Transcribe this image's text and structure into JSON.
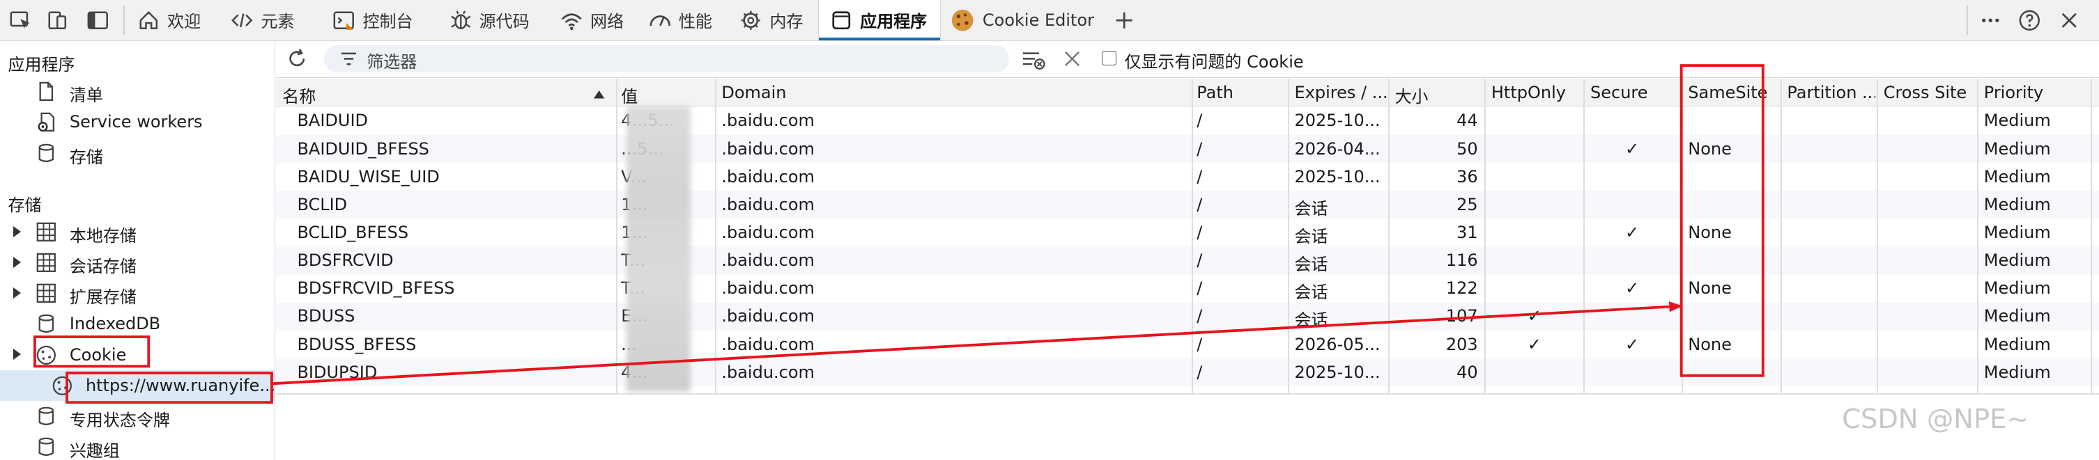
{
  "toolbar": {
    "tabs": [
      {
        "label": "欢迎",
        "icon": "home-icon"
      },
      {
        "label": "元素",
        "icon": "code-icon"
      },
      {
        "label": "控制台",
        "icon": "console-icon"
      },
      {
        "label": "源代码",
        "icon": "bug-icon"
      },
      {
        "label": "网络",
        "icon": "wifi-icon"
      },
      {
        "label": "性能",
        "icon": "gauge-icon"
      },
      {
        "label": "内存",
        "icon": "gear-icon"
      },
      {
        "label": "应用程序",
        "icon": "app-window-icon"
      },
      {
        "label": "Cookie Editor",
        "icon": "cookie-icon"
      }
    ],
    "active_tab": "应用程序"
  },
  "sidebar": {
    "app_section_title": "应用程序",
    "app_items": [
      {
        "label": "清单",
        "icon": "document-icon"
      },
      {
        "label": "Service workers",
        "icon": "gear-doc-icon"
      },
      {
        "label": "存储",
        "icon": "database-icon"
      }
    ],
    "storage_section_title": "存储",
    "storage_items": [
      {
        "label": "本地存储",
        "icon": "grid-icon",
        "expandable": true
      },
      {
        "label": "会话存储",
        "icon": "grid-icon",
        "expandable": true
      },
      {
        "label": "扩展存储",
        "icon": "grid-icon",
        "expandable": true
      },
      {
        "label": "IndexedDB",
        "icon": "database-icon",
        "expandable": false
      },
      {
        "label": "Cookie",
        "icon": "cookie-icon",
        "expandable": true
      },
      {
        "label": "https://www.ruanyife...",
        "icon": "cookie-icon",
        "expandable": false,
        "selected": true
      },
      {
        "label": "专用状态令牌",
        "icon": "database-icon",
        "expandable": false
      },
      {
        "label": "兴趣组",
        "icon": "database-icon",
        "expandable": false
      }
    ]
  },
  "filter": {
    "placeholder": "筛选器",
    "only_issues_label": "仅显示有问题的 Cookie"
  },
  "table": {
    "columns": [
      "名称",
      "值",
      "Domain",
      "Path",
      "Expires / ...",
      "大小",
      "HttpOnly",
      "Secure",
      "SameSite",
      "Partition ...",
      "Cross Site",
      "Priority"
    ],
    "rows": [
      {
        "name": "BAIDUID",
        "value": "4...5...",
        "domain": ".baidu.com",
        "path": "/",
        "expires": "2025-10...",
        "size": "44",
        "httponly": "",
        "secure": "",
        "samesite": "",
        "partition": "",
        "crosssite": "",
        "priority": "Medium"
      },
      {
        "name": "BAIDUID_BFESS",
        "value": "...5...",
        "domain": ".baidu.com",
        "path": "/",
        "expires": "2026-04...",
        "size": "50",
        "httponly": "",
        "secure": "✓",
        "samesite": "None",
        "partition": "",
        "crosssite": "",
        "priority": "Medium"
      },
      {
        "name": "BAIDU_WISE_UID",
        "value": "V...",
        "domain": ".baidu.com",
        "path": "/",
        "expires": "2025-10...",
        "size": "36",
        "httponly": "",
        "secure": "",
        "samesite": "",
        "partition": "",
        "crosssite": "",
        "priority": "Medium"
      },
      {
        "name": "BCLID",
        "value": "1...",
        "domain": ".baidu.com",
        "path": "/",
        "expires": "会话",
        "size": "25",
        "httponly": "",
        "secure": "",
        "samesite": "",
        "partition": "",
        "crosssite": "",
        "priority": "Medium"
      },
      {
        "name": "BCLID_BFESS",
        "value": "1...",
        "domain": ".baidu.com",
        "path": "/",
        "expires": "会话",
        "size": "31",
        "httponly": "",
        "secure": "✓",
        "samesite": "None",
        "partition": "",
        "crosssite": "",
        "priority": "Medium"
      },
      {
        "name": "BDSFRCVID",
        "value": "T...",
        "domain": ".baidu.com",
        "path": "/",
        "expires": "会话",
        "size": "116",
        "httponly": "",
        "secure": "",
        "samesite": "",
        "partition": "",
        "crosssite": "",
        "priority": "Medium"
      },
      {
        "name": "BDSFRCVID_BFESS",
        "value": "T...",
        "domain": ".baidu.com",
        "path": "/",
        "expires": "会话",
        "size": "122",
        "httponly": "",
        "secure": "✓",
        "samesite": "None",
        "partition": "",
        "crosssite": "",
        "priority": "Medium"
      },
      {
        "name": "BDUSS",
        "value": "E...",
        "domain": ".baidu.com",
        "path": "/",
        "expires": "会话",
        "size": "107",
        "httponly": "✓",
        "secure": "",
        "samesite": "",
        "partition": "",
        "crosssite": "",
        "priority": "Medium"
      },
      {
        "name": "BDUSS_BFESS",
        "value": "...",
        "domain": ".baidu.com",
        "path": "/",
        "expires": "2026-05...",
        "size": "203",
        "httponly": "✓",
        "secure": "✓",
        "samesite": "None",
        "partition": "",
        "crosssite": "",
        "priority": "Medium"
      },
      {
        "name": "BIDUPSID",
        "value": "4...",
        "domain": ".baidu.com",
        "path": "/",
        "expires": "2025-10...",
        "size": "40",
        "httponly": "",
        "secure": "",
        "samesite": "",
        "partition": "",
        "crosssite": "",
        "priority": "Medium"
      }
    ]
  },
  "watermark": "CSDN @NPE~",
  "annotation_color": "#e8141b",
  "accent_color": "#0f6cbd"
}
